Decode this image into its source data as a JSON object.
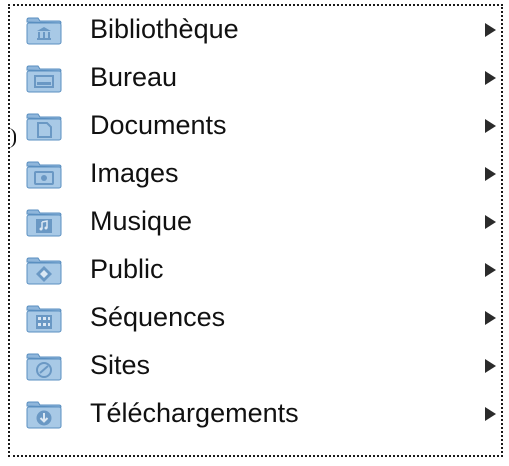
{
  "menu": {
    "items": [
      {
        "label": "Bibliothèque",
        "icon": "library-folder-icon"
      },
      {
        "label": "Bureau",
        "icon": "desktop-folder-icon"
      },
      {
        "label": "Documents",
        "icon": "documents-folder-icon"
      },
      {
        "label": "Images",
        "icon": "pictures-folder-icon"
      },
      {
        "label": "Musique",
        "icon": "music-folder-icon"
      },
      {
        "label": "Public",
        "icon": "public-folder-icon"
      },
      {
        "label": "Séquences",
        "icon": "movies-folder-icon"
      },
      {
        "label": "Sites",
        "icon": "sites-folder-icon"
      },
      {
        "label": "Téléchargements",
        "icon": "downloads-folder-icon"
      }
    ],
    "submenu_indicator": "submenu-arrow-icon",
    "colors": {
      "folder_body": "#a8c9e6",
      "folder_tab": "#8fb6db",
      "folder_border": "#5a8fc0",
      "emblem": "#6a98c4",
      "text": "#111111",
      "arrow": "#2b2b2b"
    }
  }
}
